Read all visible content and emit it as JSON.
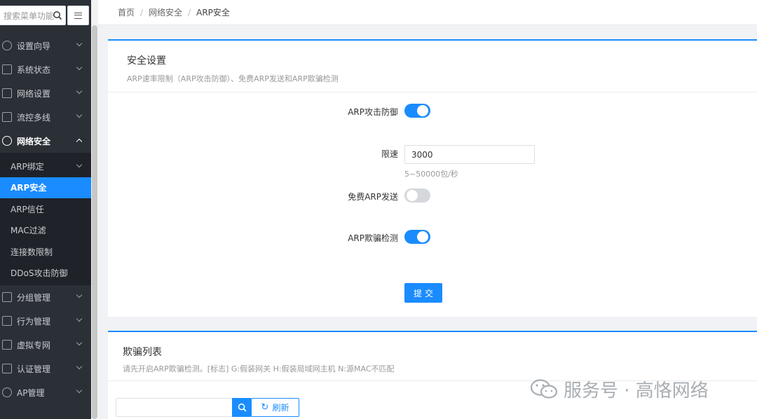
{
  "sidebar": {
    "search_placeholder": "搜索菜单功能",
    "items": [
      {
        "label": "设置向导",
        "icon": "compass-icon"
      },
      {
        "label": "系统状态",
        "icon": "chart-icon"
      },
      {
        "label": "网络设置",
        "icon": "network-icon"
      },
      {
        "label": "流控多线",
        "icon": "flow-icon"
      },
      {
        "label": "网络安全",
        "icon": "globe-icon",
        "expanded": true
      }
    ],
    "sub_items": [
      {
        "label": "ARP绑定"
      },
      {
        "label": "ARP安全",
        "active": true
      },
      {
        "label": "ARP信任"
      },
      {
        "label": "MAC过滤"
      },
      {
        "label": "连接数限制"
      },
      {
        "label": "DDoS攻击防御"
      }
    ],
    "items_after": [
      {
        "label": "分组管理",
        "icon": "group-icon"
      },
      {
        "label": "行为管理",
        "icon": "behavior-icon"
      },
      {
        "label": "虚拟专网",
        "icon": "vpn-icon"
      },
      {
        "label": "认证管理",
        "icon": "auth-icon"
      },
      {
        "label": "AP管理",
        "icon": "wifi-icon"
      }
    ]
  },
  "breadcrumb": [
    "首页",
    "网络安全",
    "ARP安全"
  ],
  "security_settings": {
    "title": "安全设置",
    "description": "ARP速率限制（ARP攻击防御）、免费ARP发送和ARP欺骗检测",
    "arp_attack_defense": {
      "label": "ARP攻击防御",
      "enabled": true
    },
    "rate_limit": {
      "label": "限速",
      "value": "3000",
      "hint": "5~50000包/秒"
    },
    "gratuitous_arp": {
      "label": "免费ARP发送",
      "enabled": false
    },
    "arp_spoof_detect": {
      "label": "ARP欺骗检测",
      "enabled": true
    },
    "submit_label": "提交"
  },
  "spoof_list": {
    "title": "欺骗列表",
    "description": "请先开启ARP欺骗检测。[标志] G:假装网关 H:假装局域网主机 N:源MAC不匹配",
    "search_placeholder": "",
    "refresh_label": "刷新"
  },
  "watermark": "服务号 · 高恪网络",
  "colors": {
    "accent": "#1a8cff",
    "sidebar_bg": "#2b3037",
    "submenu_bg": "#1f2329"
  }
}
